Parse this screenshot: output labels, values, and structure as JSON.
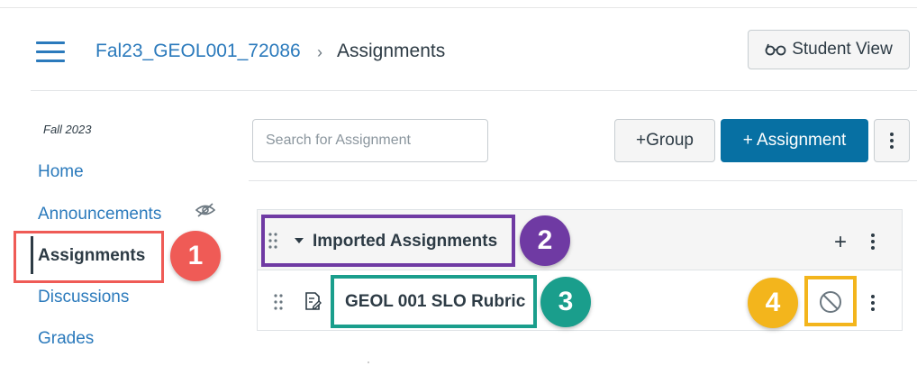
{
  "header": {
    "course_link": "Fal23_GEOL001_72086",
    "separator": "›",
    "current_page": "Assignments",
    "student_view_label": "Student View"
  },
  "sidebar": {
    "term": "Fall 2023",
    "items": [
      {
        "label": "Home"
      },
      {
        "label": "Announcements"
      },
      {
        "label": "Assignments"
      },
      {
        "label": "Discussions"
      },
      {
        "label": "Grades"
      }
    ]
  },
  "toolbar": {
    "search_placeholder": "Search for Assignment",
    "group_button": "+Group",
    "assignment_button": "+ Assignment"
  },
  "group": {
    "title": "Imported Assignments",
    "items": [
      {
        "title": "GEOL 001 SLO Rubric"
      }
    ]
  },
  "callouts": [
    "1",
    "2",
    "3",
    "4"
  ],
  "colors": {
    "link": "#2b7abc",
    "primary_button": "#0770a3",
    "callout_1": "#ef5b56",
    "callout_2": "#6f3aa3",
    "callout_3": "#1a9e8c",
    "callout_4": "#f3b51c"
  }
}
